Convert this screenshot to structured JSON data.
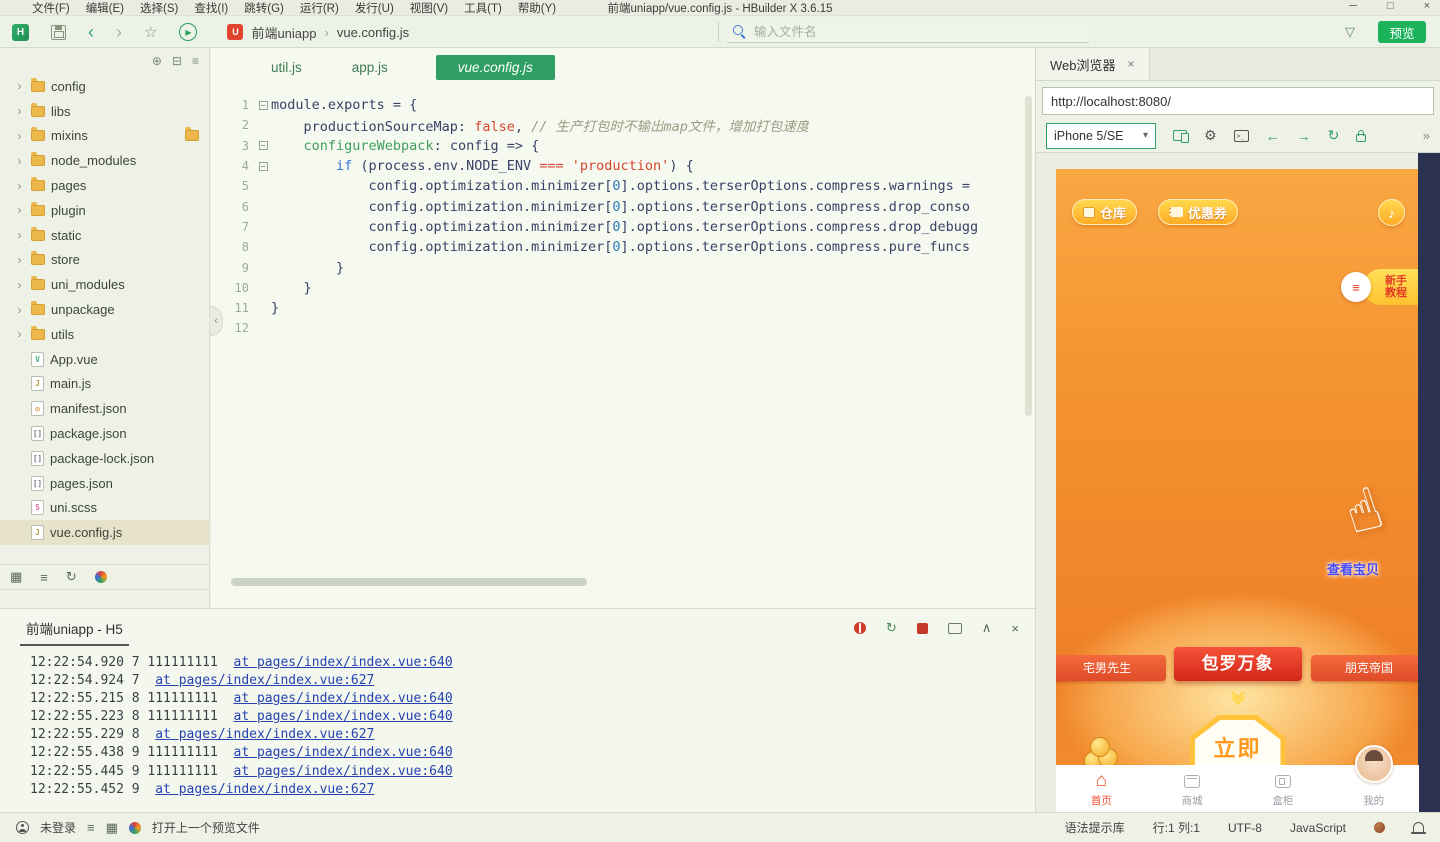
{
  "window": {
    "title": "前端uniapp/vue.config.js - HBuilder X 3.6.15",
    "menus": [
      "文件(F)",
      "编辑(E)",
      "选择(S)",
      "查找(I)",
      "跳转(G)",
      "运行(R)",
      "发行(U)",
      "视图(V)",
      "工具(T)",
      "帮助(Y)"
    ]
  },
  "toolbar": {
    "breadcrumb": {
      "root": "前端uniapp",
      "file": "vue.config.js"
    },
    "search_placeholder": "输入文件名",
    "preview_label": "预览"
  },
  "sidebar": {
    "folders": [
      {
        "name": "config"
      },
      {
        "name": "libs"
      },
      {
        "name": "mixins",
        "badge": true
      },
      {
        "name": "node_modules"
      },
      {
        "name": "pages"
      },
      {
        "name": "plugin"
      },
      {
        "name": "static"
      },
      {
        "name": "store"
      },
      {
        "name": "uni_modules"
      },
      {
        "name": "unpackage"
      },
      {
        "name": "utils"
      }
    ],
    "files": [
      {
        "name": "App.vue",
        "icon": "vue"
      },
      {
        "name": "main.js",
        "icon": "js"
      },
      {
        "name": "manifest.json",
        "icon": "manifest"
      },
      {
        "name": "package.json",
        "icon": "brackets"
      },
      {
        "name": "package-lock.json",
        "icon": "brackets"
      },
      {
        "name": "pages.json",
        "icon": "brackets"
      },
      {
        "name": "uni.scss",
        "icon": "scss"
      },
      {
        "name": "vue.config.js",
        "icon": "js",
        "selected": true
      }
    ]
  },
  "editor": {
    "tabs": [
      {
        "label": "util.js"
      },
      {
        "label": "app.js"
      },
      {
        "label": "vue.config.js",
        "active": true
      }
    ],
    "code": [
      {
        "n": "1",
        "fold": true,
        "seg": [
          [
            "module.exports = {",
            "p"
          ]
        ]
      },
      {
        "n": "2",
        "fold": false,
        "seg": [
          [
            "    productionSourceMap: ",
            "p"
          ],
          [
            "false",
            "r"
          ],
          [
            ", ",
            "p"
          ],
          [
            "// 生产打包时不输出map文件，增加打包速度",
            "c"
          ]
        ]
      },
      {
        "n": "3",
        "fold": true,
        "seg": [
          [
            "    ",
            "p"
          ],
          [
            "configureWebpack",
            "g"
          ],
          [
            ": config => {",
            "p"
          ]
        ]
      },
      {
        "n": "4",
        "fold": true,
        "seg": [
          [
            "        ",
            "p"
          ],
          [
            "if",
            "b"
          ],
          [
            " (process.env.NODE_ENV ",
            "p"
          ],
          [
            "===",
            "r"
          ],
          [
            " ",
            "p"
          ],
          [
            "'production'",
            "s"
          ],
          [
            ") {",
            "p"
          ]
        ]
      },
      {
        "n": "5",
        "fold": false,
        "seg": [
          [
            "            config.optimization.minimizer[",
            "p"
          ],
          [
            "0",
            "num"
          ],
          [
            "].options.terserOptions.compress.warnings =",
            "p"
          ]
        ]
      },
      {
        "n": "6",
        "fold": false,
        "seg": [
          [
            "            config.optimization.minimizer[",
            "p"
          ],
          [
            "0",
            "num"
          ],
          [
            "].options.terserOptions.compress.drop_conso",
            "p"
          ]
        ]
      },
      {
        "n": "7",
        "fold": false,
        "seg": [
          [
            "            config.optimization.minimizer[",
            "p"
          ],
          [
            "0",
            "num"
          ],
          [
            "].options.terserOptions.compress.drop_debugg",
            "p"
          ]
        ]
      },
      {
        "n": "8",
        "fold": false,
        "seg": [
          [
            "            config.optimization.minimizer[",
            "p"
          ],
          [
            "0",
            "num"
          ],
          [
            "].options.terserOptions.compress.pure_funcs",
            "p"
          ]
        ]
      },
      {
        "n": "9",
        "fold": false,
        "seg": [
          [
            "        }",
            "p"
          ]
        ]
      },
      {
        "n": "10",
        "fold": false,
        "seg": [
          [
            "    }",
            "p"
          ]
        ]
      },
      {
        "n": "11",
        "fold": false,
        "seg": [
          [
            "}",
            "p"
          ]
        ]
      },
      {
        "n": "12",
        "fold": false,
        "seg": [
          [
            "",
            ""
          ]
        ]
      }
    ]
  },
  "console": {
    "tab_label": "前端uniapp - H5",
    "lines": [
      {
        "pre": "12:22:54.920 7 111111111  ",
        "link": "at pages/index/index.vue:640"
      },
      {
        "pre": "12:22:54.924 7  ",
        "link": "at pages/index/index.vue:627"
      },
      {
        "pre": "12:22:55.215 8 111111111  ",
        "link": "at pages/index/index.vue:640"
      },
      {
        "pre": "12:22:55.223 8 111111111  ",
        "link": "at pages/index/index.vue:640"
      },
      {
        "pre": "12:22:55.229 8  ",
        "link": "at pages/index/index.vue:627"
      },
      {
        "pre": "12:22:55.438 9 111111111  ",
        "link": "at pages/index/index.vue:640"
      },
      {
        "pre": "12:22:55.445 9 111111111  ",
        "link": "at pages/index/index.vue:640"
      },
      {
        "pre": "12:22:55.452 9  ",
        "link": "at pages/index/index.vue:627"
      }
    ]
  },
  "browser": {
    "tab_label": "Web浏览器",
    "url": "http://localhost:8080/",
    "device": "iPhone 5/SE",
    "app": {
      "warehouse": "仓库",
      "coupon": "优惠券",
      "tutorial": [
        "新手",
        "教程"
      ],
      "view_treasure": "查看宝贝",
      "banners": [
        "宅男先生",
        "包罗万象",
        "朋克帝国"
      ],
      "cta": "立即",
      "tabs": [
        {
          "label": "首页",
          "icon": "home",
          "active": true
        },
        {
          "label": "商城",
          "icon": "shop"
        },
        {
          "label": "盒柜",
          "icon": "locker"
        },
        {
          "label": "我的",
          "icon": "avatar"
        }
      ]
    }
  },
  "statusbar": {
    "login": "未登录",
    "open_last": "打开上一个预览文件",
    "right": [
      "语法提示库",
      "行:1 列:1",
      "UTF-8",
      "JavaScript"
    ]
  },
  "icons": {
    "minimize": "─",
    "maximize": "□",
    "close": "×",
    "back": "‹",
    "forward": "›",
    "star": "☆",
    "run": "▶",
    "crumb": "›",
    "filter": "▽",
    "caret_r": "›",
    "caret_d": "▾",
    "plus_circle": "⊕",
    "collapse_all": "⊟",
    "menu": "≡",
    "more": "»",
    "gear": "⚙",
    "arrow_left": "←",
    "arrow_right": "→",
    "refresh": "↻",
    "music": "♪",
    "hand": "☝",
    "home": "⌂",
    "up": "∧",
    "clear": "×",
    "restart": "↻",
    "uni": "U",
    "logo": "H",
    "list": "≡",
    "grid": "▦",
    "doc": "≡"
  },
  "file_icons": {
    "vue": [
      "V",
      "#3fae7e"
    ],
    "js": [
      "J",
      "#b49a3c"
    ],
    "manifest": [
      "◎",
      "#e0872e"
    ],
    "brackets": [
      "[]",
      "#6a7280"
    ],
    "scss": [
      "S",
      "#d4679a"
    ]
  }
}
